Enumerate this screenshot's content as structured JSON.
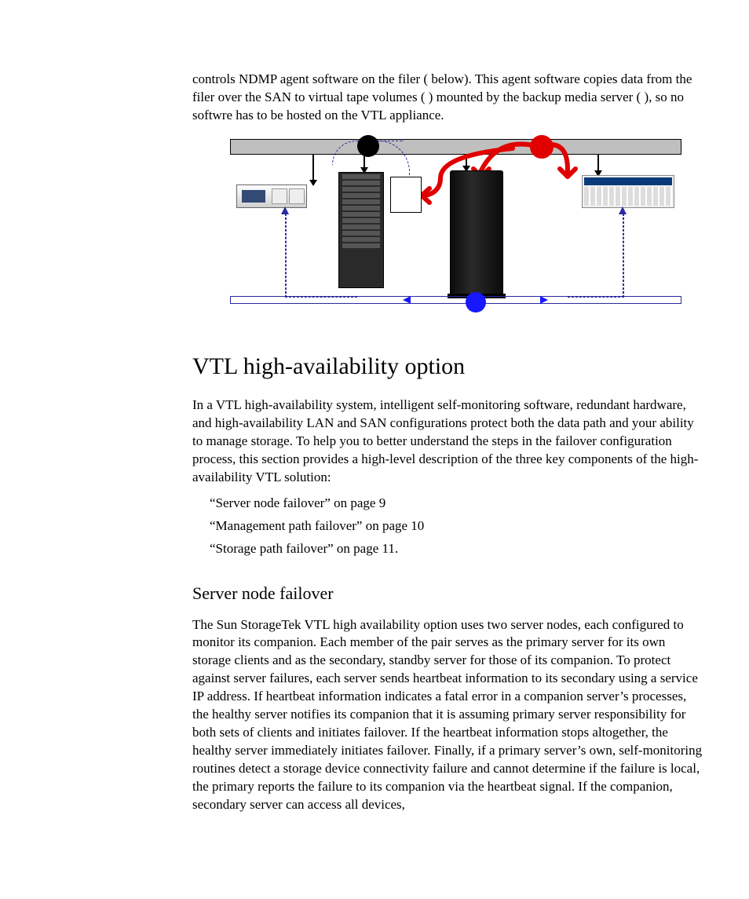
{
  "intro_para": "controls NDMP agent software on the filer (   below). This agent software copies data from the filer over the SAN to virtual tape volumes ( ) mounted by the backup media server (  ), so no softwre has to be hosted on the VTL appliance.",
  "heading1": "VTL high-availability option",
  "para1": "In a VTL high-availability system, intelligent self-monitoring software, redundant hardware, and high-availability LAN and SAN configurations protect both the data path and your ability to manage storage. To help you to better understand the steps in the failover configuration process, this section provides a high-level description of the three key components of the high-availability VTL solution:",
  "bullets": [
    "“Server node failover” on page 9",
    "“Management path failover” on page 10",
    "“Storage path failover” on page 11."
  ],
  "heading2": "Server node failover",
  "para2": "The Sun StorageTek VTL high availability option uses two server nodes, each configured to monitor its companion. Each member of the pair serves as the primary server for its own storage clients and as the secondary, standby server for those of its companion. To protect against server failures, each server sends heartbeat information to its secondary using a service IP address. If heartbeat information indicates a fatal error in a companion server’s processes, the healthy server notifies its companion that it is assuming primary server responsibility for both sets of clients and initiates failover. If the heartbeat information stops altogether, the healthy server immediately initiates failover. Finally, if a primary server’s own, self-monitoring routines detect a storage device connectivity failure and cannot determine if the failure is local, the primary reports the failure to its companion via the heartbeat signal. If the companion, secondary server can access all devices,",
  "figure": {
    "devices": {
      "backup_media_server": "backup-media-server",
      "vtl_rack": "vtl-appliance-rack",
      "control_box": "ndmp-control-box",
      "tape_library": "virtual-tape-library",
      "nas_filer": "nas-filer"
    },
    "networks": {
      "top_bar": "lan-bar",
      "lan_dot": "lan-junction",
      "red_dot": "filer-junction",
      "bottom_bar": "san-bar",
      "san_dot": "san-junction"
    }
  }
}
